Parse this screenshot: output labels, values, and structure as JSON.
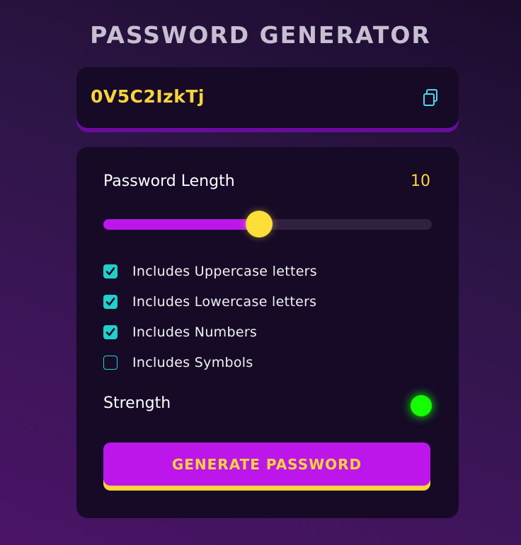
{
  "app": {
    "title": "PASSWORD GENERATOR"
  },
  "display": {
    "password": "0V5C2IzkTj",
    "copy_icon": "copy-icon"
  },
  "length": {
    "label": "Password Length",
    "value": "10",
    "slider_fraction": 0.475
  },
  "options": [
    {
      "label": "Includes Uppercase letters",
      "checked": true
    },
    {
      "label": "Includes Lowercase letters",
      "checked": true
    },
    {
      "label": "Includes Numbers",
      "checked": true
    },
    {
      "label": "Includes Symbols",
      "checked": false
    }
  ],
  "strength": {
    "label": "Strength",
    "indicator_color": "#14ff00"
  },
  "generate": {
    "label": "GENERATE PASSWORD"
  },
  "colors": {
    "accent_purple": "#bd16eb",
    "accent_yellow": "#ffd43b",
    "checkbox_teal": "#21cfcb",
    "panel_bg": "#160a27"
  }
}
